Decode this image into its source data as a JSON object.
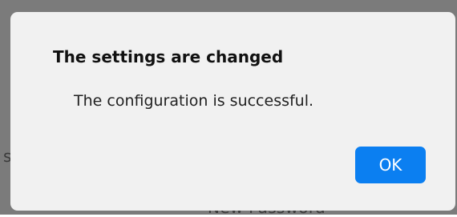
{
  "background": {
    "partial_char": "s",
    "partial_label": "New Password"
  },
  "dialog": {
    "title": "The settings are changed",
    "message": "The configuration is successful.",
    "ok_label": "OK"
  },
  "colors": {
    "overlay": "#7b7b7b",
    "dialog_bg": "#f1f1f1",
    "accent": "#0b7ff1"
  }
}
